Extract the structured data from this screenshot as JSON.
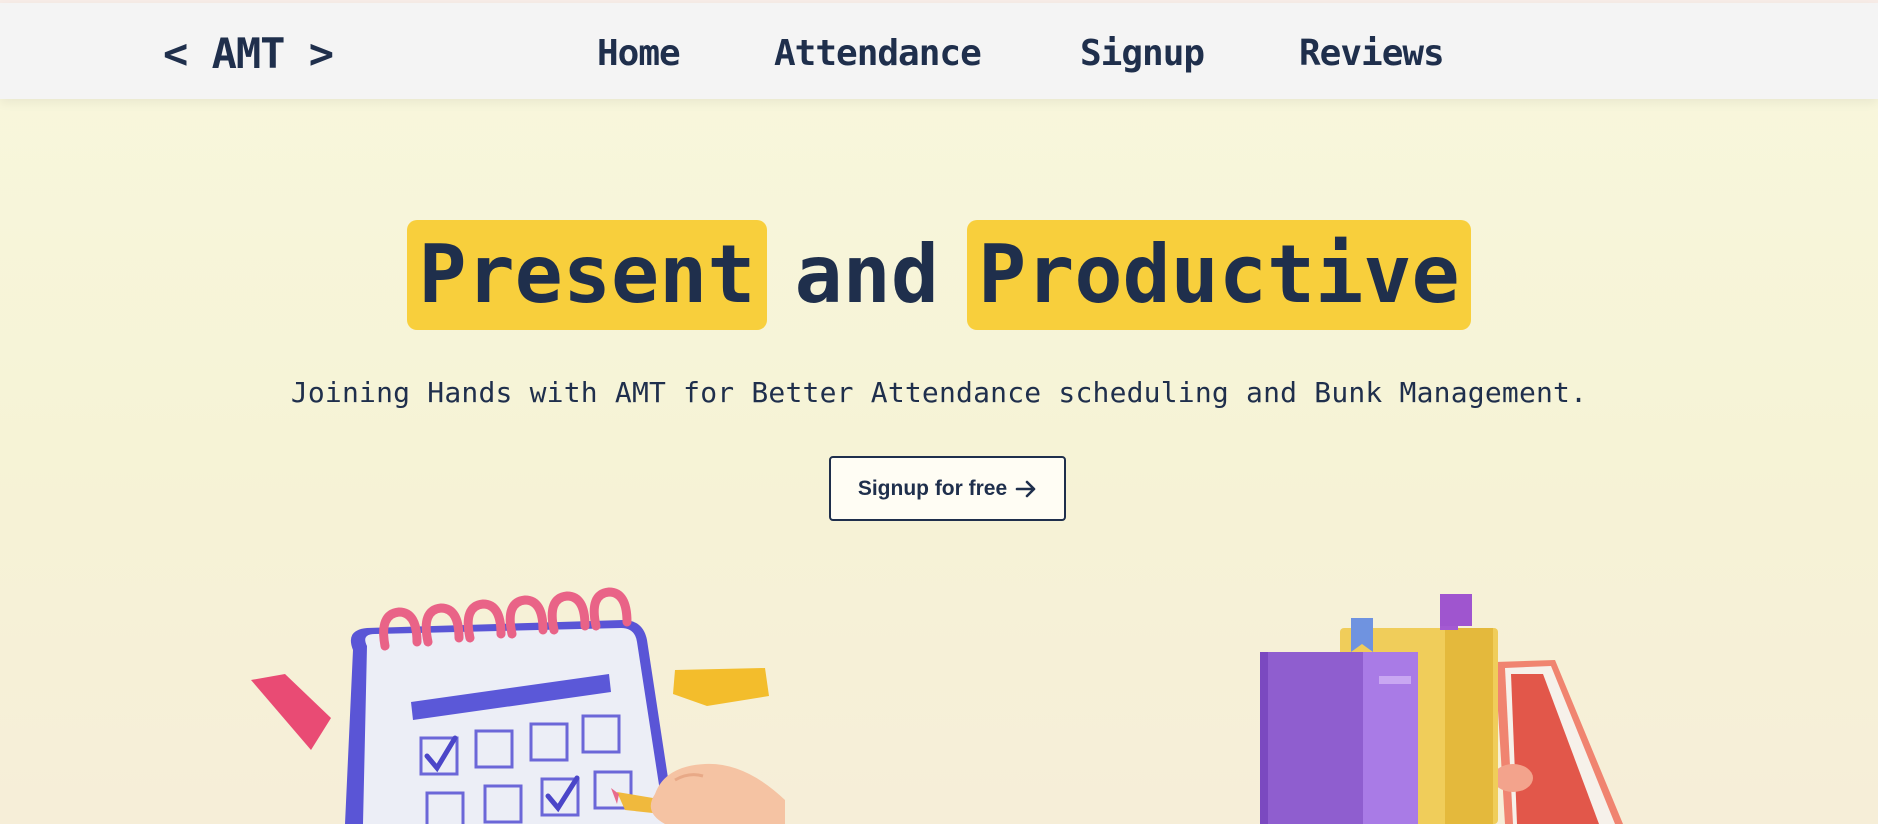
{
  "nav": {
    "logo": "< AMT >",
    "links": [
      "Home",
      "Attendance",
      "Signup",
      "Reviews"
    ]
  },
  "hero": {
    "title_part1": "Present",
    "title_middle": "and",
    "title_part2": "Productive",
    "subtitle": "Joining Hands with AMT for Better Attendance scheduling and Bunk Management.",
    "cta_label": "Signup for free"
  },
  "colors": {
    "primary": "#1f2f4c",
    "highlight": "#f8cf3c",
    "background": "#f8f7dd",
    "navbar": "#f4f4f4"
  },
  "icons": {
    "cta_arrow": "arrow-right-icon",
    "left_illustration": "calendar-checklist-illustration",
    "right_illustration": "books-stack-illustration"
  }
}
